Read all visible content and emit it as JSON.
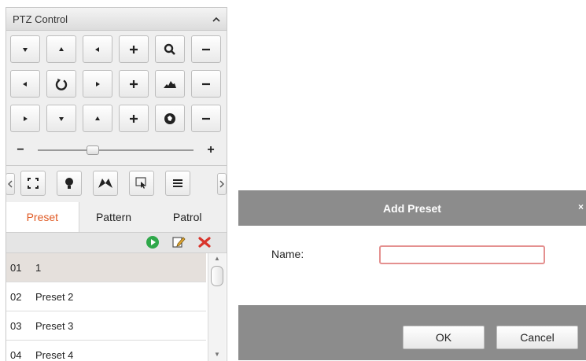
{
  "ptz": {
    "title": "PTZ Control",
    "collapse_icon": "chevron-up-icon",
    "speed": {
      "minus": "−",
      "plus": "+",
      "level": 0.35
    },
    "direction_buttons": [
      "pan-up-left",
      "pan-up",
      "pan-up-right",
      "pan-left",
      "auto-scan",
      "pan-right",
      "pan-down-left",
      "pan-down",
      "pan-down-right"
    ],
    "lens_rows": [
      {
        "icon": "zoom-icon",
        "plus": "+",
        "minus": "−"
      },
      {
        "icon": "focus-icon",
        "plus": "+",
        "minus": "−"
      },
      {
        "icon": "iris-icon",
        "plus": "+",
        "minus": "−"
      }
    ],
    "aux_buttons": [
      "3d-positioning-icon",
      "light-icon",
      "wiper-icon",
      "one-touch-focus-icon",
      "menu-icon"
    ],
    "tabs": [
      "Preset",
      "Pattern",
      "Patrol"
    ],
    "active_tab": "Preset",
    "toolbar_icons": [
      "call-preset-icon",
      "edit-icon",
      "delete-icon"
    ],
    "presets": [
      {
        "num": "01",
        "name": "1"
      },
      {
        "num": "02",
        "name": "Preset 2"
      },
      {
        "num": "03",
        "name": "Preset 3"
      },
      {
        "num": "04",
        "name": "Preset 4"
      }
    ]
  },
  "dialog": {
    "title": "Add Preset",
    "close": "×",
    "name_label": "Name:",
    "name_value": "",
    "ok": "OK",
    "cancel": "Cancel"
  },
  "colors": {
    "active_tab": "#e05a24",
    "dialog_bar": "#8c8c8c",
    "input_border": "#e4908f",
    "selected_row": "#e5e0dc"
  }
}
